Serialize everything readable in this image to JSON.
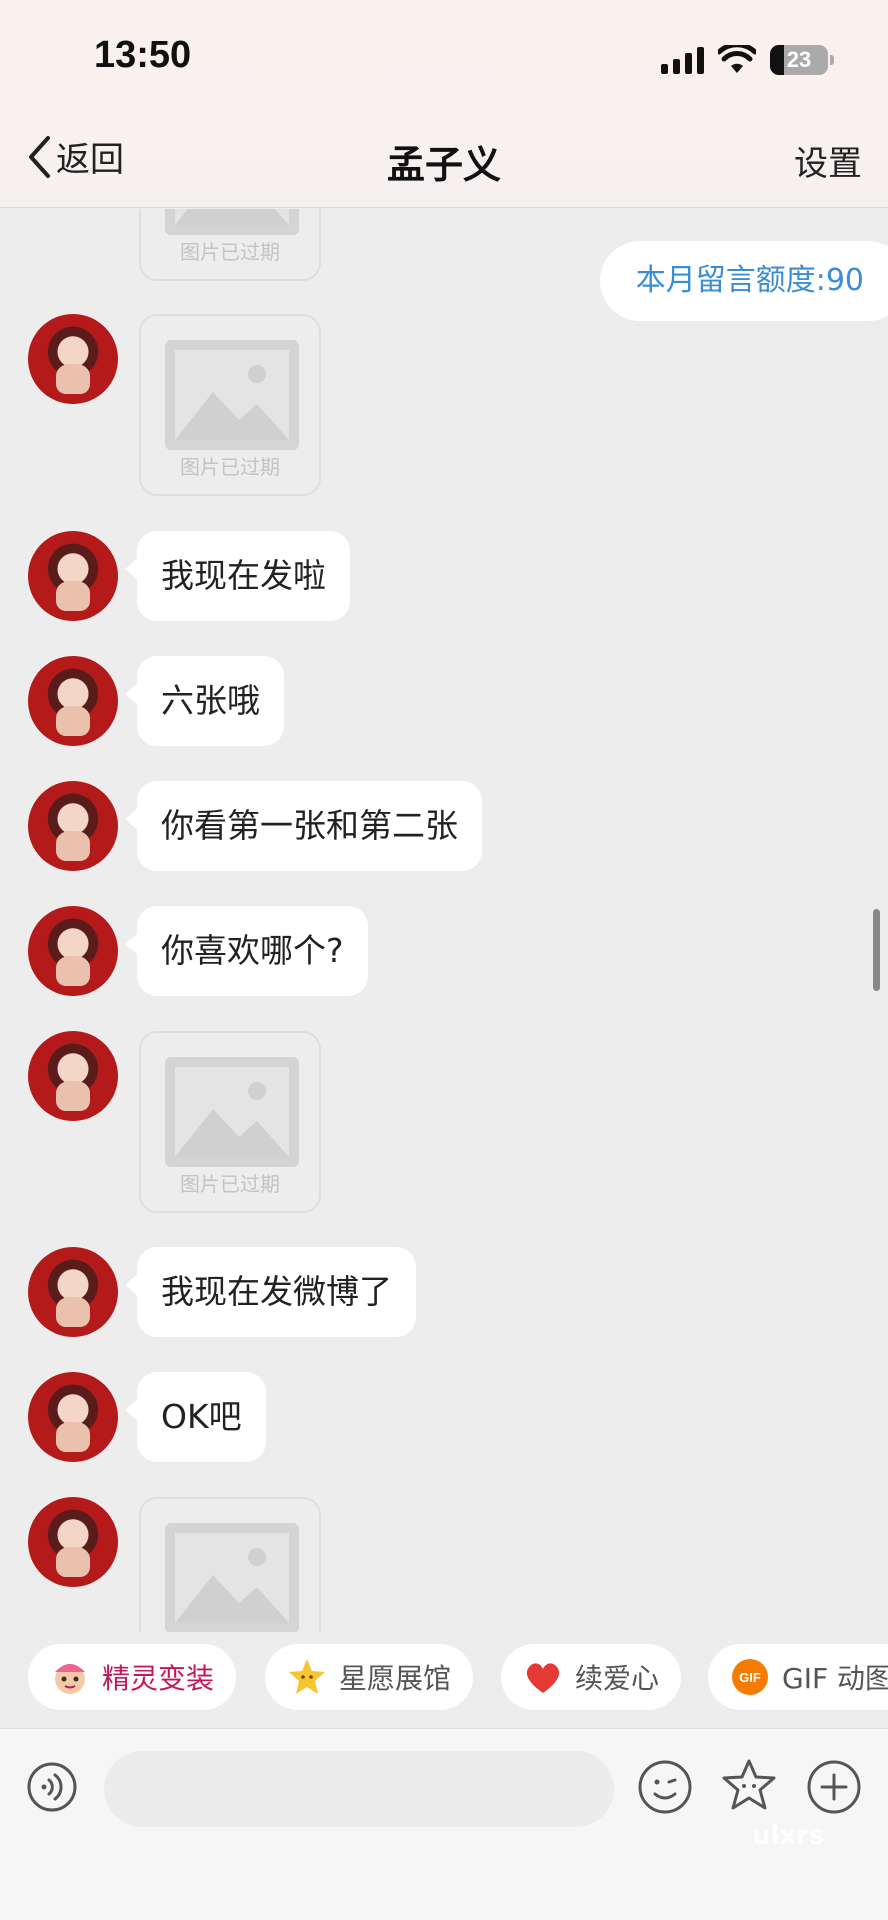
{
  "status_bar": {
    "time": "13:50",
    "battery": "23"
  },
  "nav": {
    "back_label": "返回",
    "title": "孟子义",
    "settings_label": "设置"
  },
  "quota_label": "本月留言额度:90",
  "expired_label": "图片已过期",
  "messages": [
    {
      "type": "image"
    },
    {
      "type": "image"
    },
    {
      "type": "text",
      "text": "我现在发啦"
    },
    {
      "type": "text",
      "text": "六张哦"
    },
    {
      "type": "text",
      "text": "你看第一张和第二张"
    },
    {
      "type": "text",
      "text": "你喜欢哪个?"
    },
    {
      "type": "image"
    },
    {
      "type": "text",
      "text": "我现在发微博了"
    },
    {
      "type": "text",
      "text": "OK吧"
    },
    {
      "type": "image"
    }
  ],
  "quick_actions": [
    {
      "label": "精灵变装",
      "icon": "sprite-icon",
      "color": "#c2185b"
    },
    {
      "label": "星愿展馆",
      "icon": "star-icon",
      "color": "#555555"
    },
    {
      "label": "续爱心",
      "icon": "heart-icon",
      "color": "#555555"
    },
    {
      "label": "GIF 动图",
      "icon": "gif-icon",
      "color": "#555555"
    }
  ],
  "input_bar": {
    "watermark": "ulxrs"
  },
  "colors": {
    "accent_blue": "#3b8ed6",
    "heart_red": "#e53935",
    "star_yellow": "#f7c531"
  }
}
